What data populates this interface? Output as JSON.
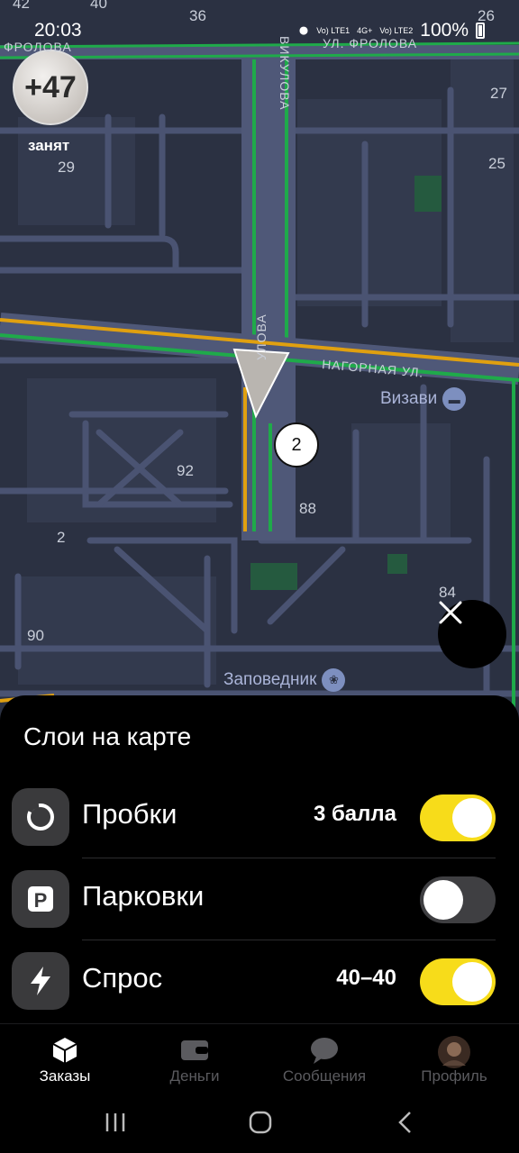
{
  "status_bar": {
    "time": "20:03",
    "sim1": "Vo) LTE1",
    "network": "4G+",
    "sim2": "Vo) LTE2",
    "battery": "100%"
  },
  "map": {
    "coefficient": "+47",
    "driver_status": "занят",
    "cluster_count": "2",
    "numbers": [
      "42",
      "40",
      "36",
      "26",
      "27",
      "25",
      "29",
      "92",
      "88",
      "2",
      "84",
      "90"
    ],
    "streets": {
      "frolova_left": "ФРОЛОВА",
      "frolova_right": "УЛ. ФРОЛОВА",
      "vikulova_top": "ВИКУЛОВА",
      "vikulova_mid": "УЛОВА",
      "nagornaya": "НАГОРНАЯ УЛ."
    },
    "pois": {
      "vizavi": "Визави",
      "zapovednik": "Заповедник"
    },
    "colors": {
      "background": "#2b3142",
      "road": "#4a5372",
      "traffic_green": "#1faa4a",
      "traffic_yellow": "#e0a010"
    }
  },
  "sheet": {
    "title": "Слои на карте",
    "layers": [
      {
        "name": "Пробки",
        "value": "3 балла",
        "enabled": true,
        "icon": "traffic-icon"
      },
      {
        "name": "Парковки",
        "value": "",
        "enabled": false,
        "icon": "parking-icon"
      },
      {
        "name": "Спрос",
        "value": "40–40",
        "enabled": true,
        "icon": "lightning-icon"
      }
    ],
    "toggle_on_color": "#f7dc1a"
  },
  "tabbar": {
    "tabs": [
      {
        "label": "Заказы",
        "icon": "box-icon",
        "active": true
      },
      {
        "label": "Деньги",
        "icon": "wallet-icon",
        "active": false
      },
      {
        "label": "Сообщения",
        "icon": "chat-icon",
        "active": false
      },
      {
        "label": "Профиль",
        "icon": "avatar-icon",
        "active": false
      }
    ]
  }
}
